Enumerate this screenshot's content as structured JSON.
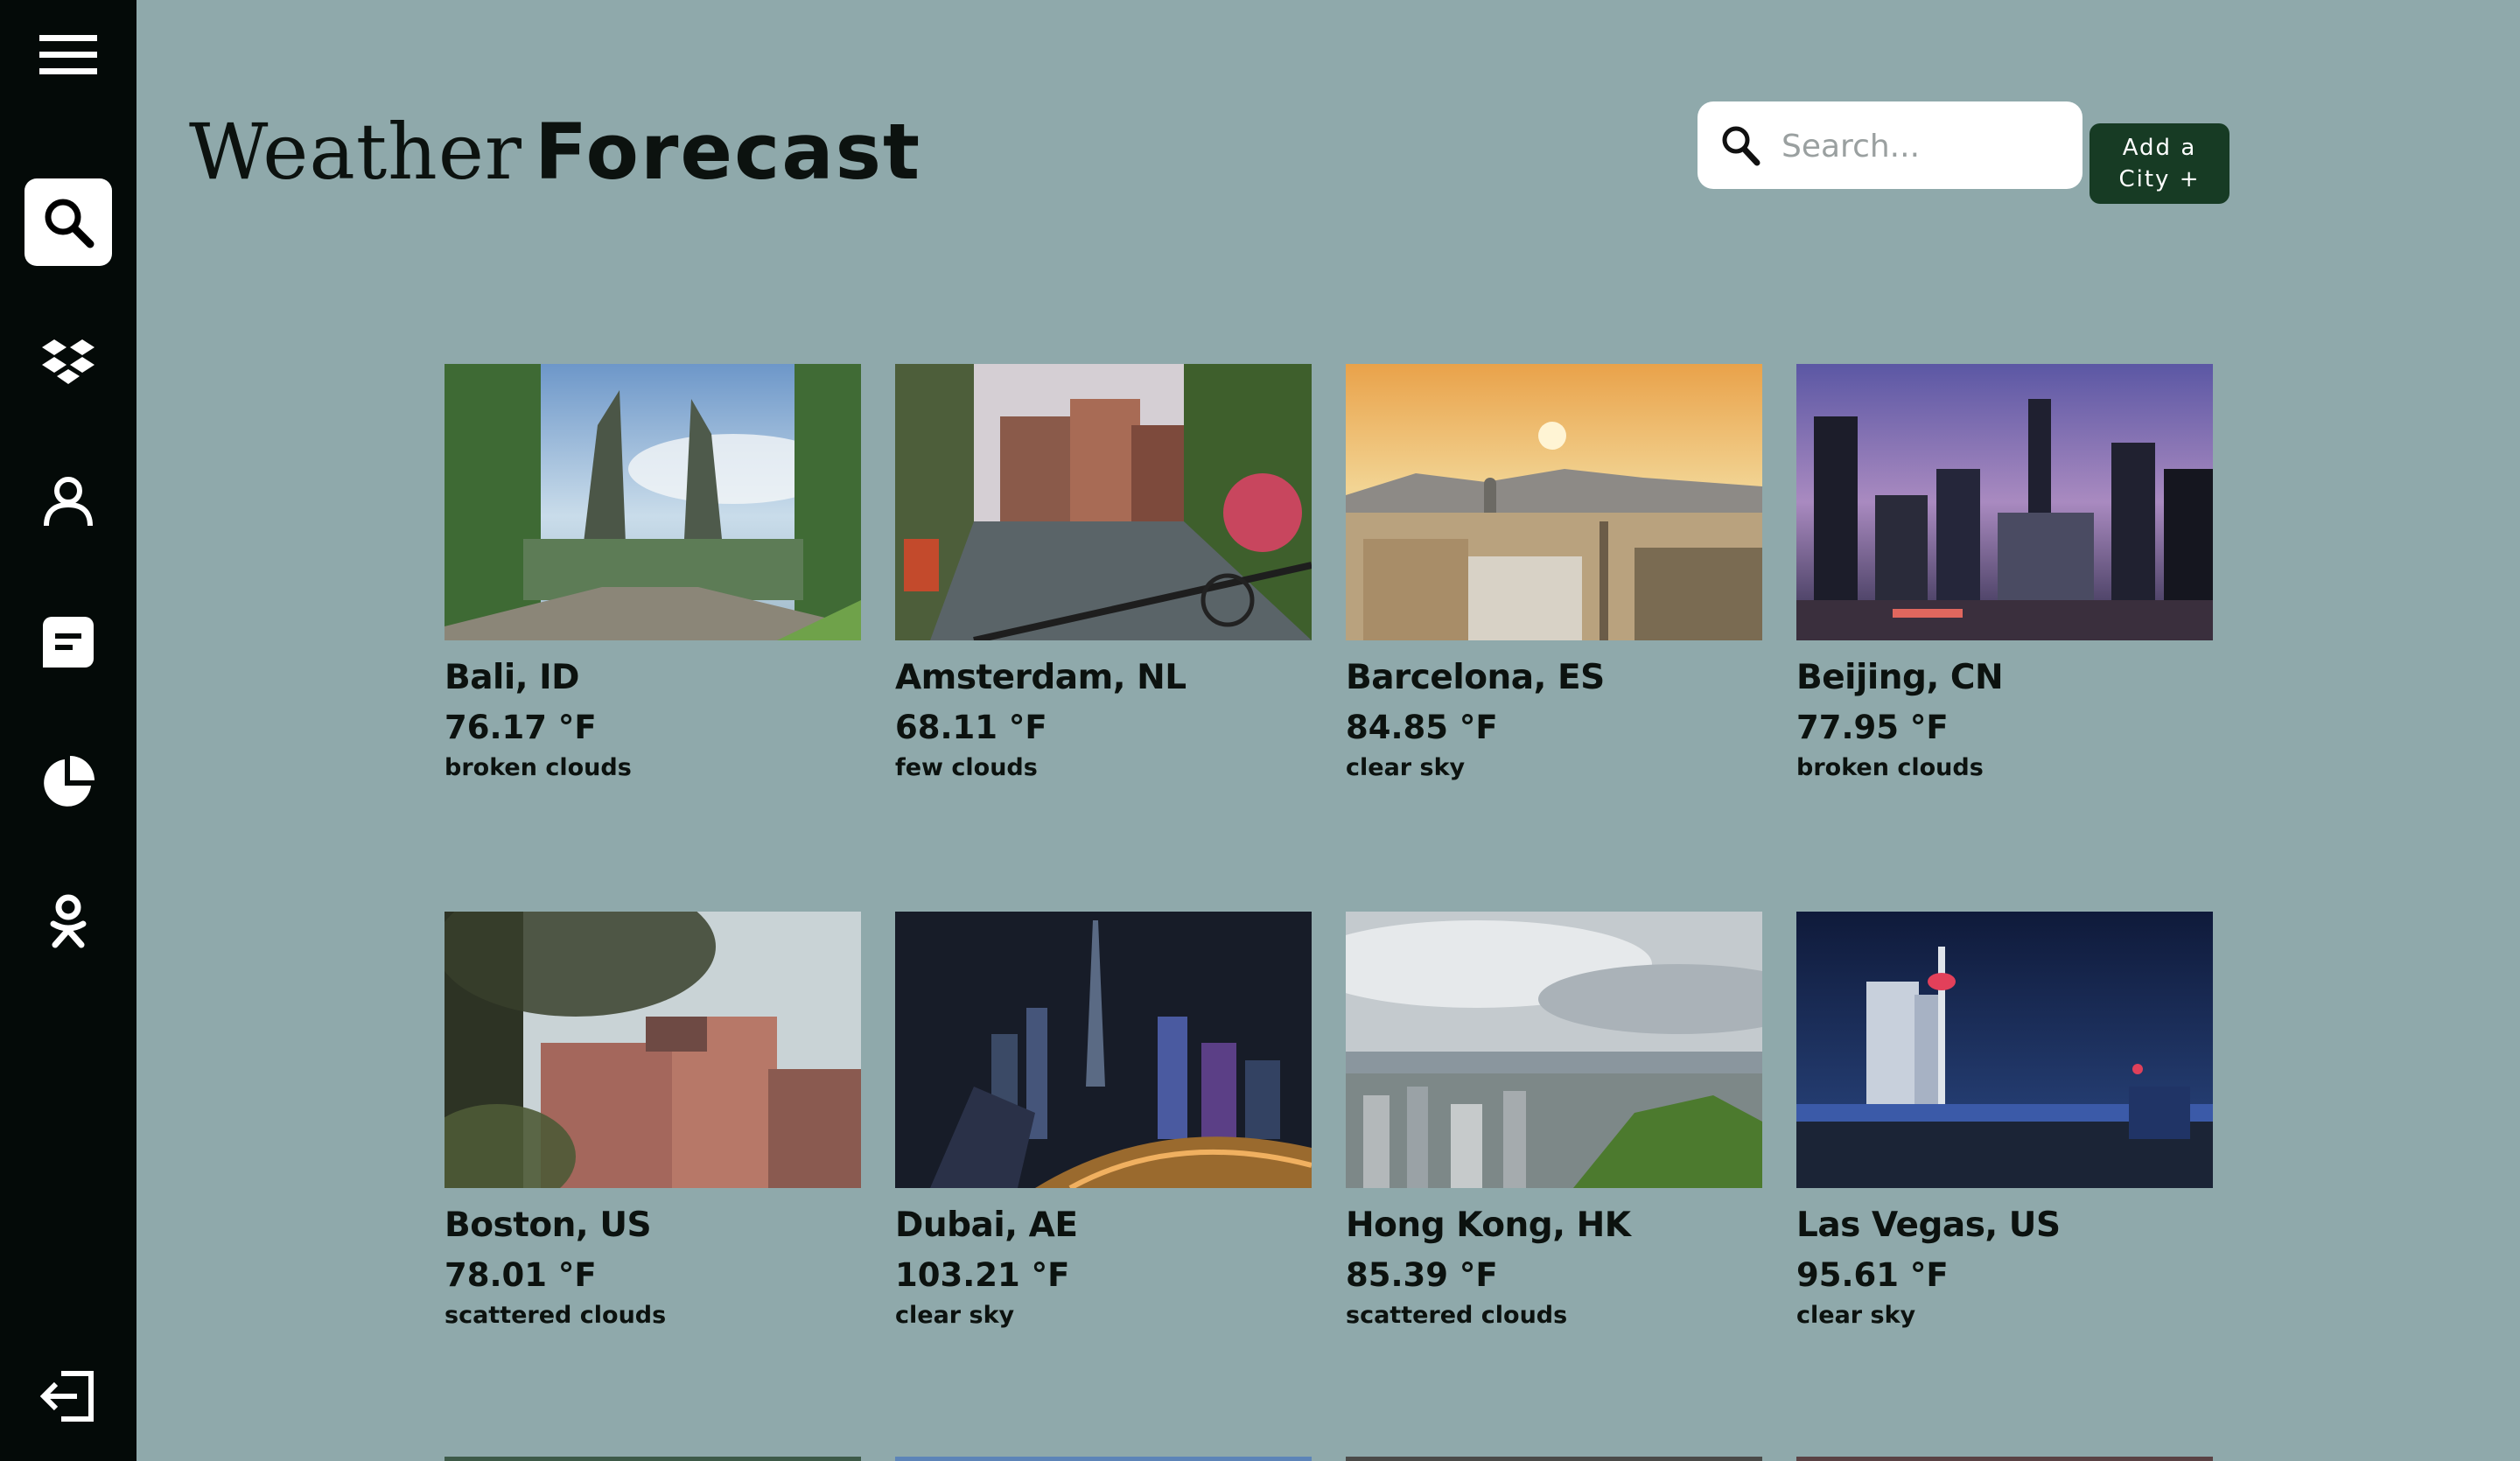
{
  "sidebar": {
    "menu_icon": "hamburger-menu-icon",
    "items": [
      {
        "icon": "search-icon",
        "active": true
      },
      {
        "icon": "dropbox-icon",
        "active": false
      },
      {
        "icon": "user-icon",
        "active": false
      },
      {
        "icon": "chat-icon",
        "active": false
      },
      {
        "icon": "pie-chart-icon",
        "active": false
      },
      {
        "icon": "odnoklassniki-icon",
        "active": false
      }
    ],
    "logout_icon": "logout-icon"
  },
  "header": {
    "title_light": "Weather",
    "title_bold": "Forecast"
  },
  "search": {
    "placeholder": "Search..."
  },
  "add_city": {
    "label": "Add a\nCity +"
  },
  "cities": [
    {
      "name": "Bali, ID",
      "temp": "76.17 °F",
      "desc": "broken clouds"
    },
    {
      "name": "Amsterdam, NL",
      "temp": "68.11 °F",
      "desc": "few clouds"
    },
    {
      "name": "Barcelona, ES",
      "temp": "84.85 °F",
      "desc": "clear sky"
    },
    {
      "name": "Beijing, CN",
      "temp": "77.95 °F",
      "desc": "broken clouds"
    },
    {
      "name": "Boston, US",
      "temp": "78.01 °F",
      "desc": "scattered clouds"
    },
    {
      "name": "Dubai, AE",
      "temp": "103.21 °F",
      "desc": "clear sky"
    },
    {
      "name": "Hong Kong, HK",
      "temp": "85.39 °F",
      "desc": "scattered clouds"
    },
    {
      "name": "Las Vegas, US",
      "temp": "95.61 °F",
      "desc": "clear sky"
    }
  ],
  "colors": {
    "background": "#8fa9ab",
    "sidebar": "#040a08",
    "accent_button": "#173b24"
  }
}
